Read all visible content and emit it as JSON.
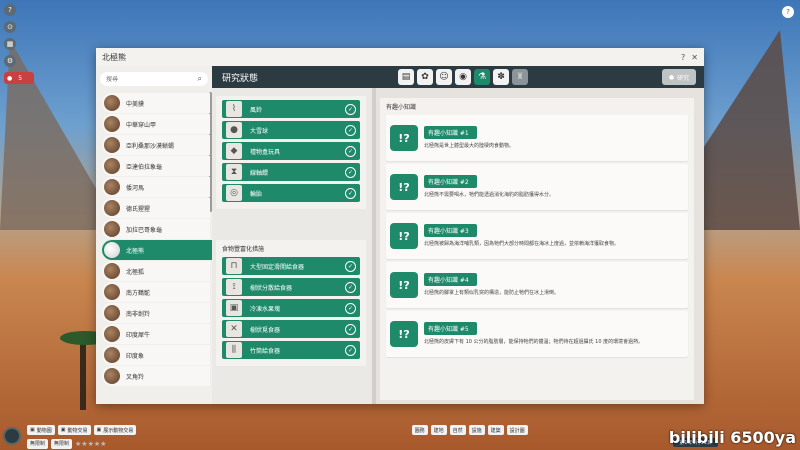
{
  "window": {
    "title": "北極熊",
    "help": "?",
    "close": "✕"
  },
  "search": {
    "placeholder": "搜尋"
  },
  "animals": [
    {
      "name": "中美貘"
    },
    {
      "name": "中華穿山甲"
    },
    {
      "name": "亞利桑那沙漠蜥蜴"
    },
    {
      "name": "亞達伯拉象龜"
    },
    {
      "name": "倭河馬"
    },
    {
      "name": "德氏猩猩"
    },
    {
      "name": "加拉巴哥象龜"
    },
    {
      "name": "北極熊"
    },
    {
      "name": "北極狐"
    },
    {
      "name": "南方鶴鴕"
    },
    {
      "name": "南非劍羚"
    },
    {
      "name": "印度犀牛"
    },
    {
      "name": "印度象"
    },
    {
      "name": "叉角羚"
    }
  ],
  "main": {
    "title": "研究狀態",
    "disabled_btn": "研究"
  },
  "category_icons": [
    "doc-icon",
    "food-icon",
    "guest-icon",
    "bag-icon",
    "flask-icon",
    "paw-icon",
    "trophy-icon"
  ],
  "enrichment": [
    {
      "label": "風鈴",
      "icon": "wind-chime-icon"
    },
    {
      "label": "大雪球",
      "icon": "snowball-icon"
    },
    {
      "label": "禮物盒玩具",
      "icon": "gift-box-icon"
    },
    {
      "label": "線軸餵",
      "icon": "spool-icon"
    },
    {
      "label": "輪胎",
      "icon": "tire-icon"
    }
  ],
  "feeding": {
    "title": "食物豐富化措施",
    "items": [
      {
        "label": "大型固定滑開給食器",
        "icon": "feeder-icon"
      },
      {
        "label": "樹狀分散給食器",
        "icon": "tree-feeder-icon"
      },
      {
        "label": "冷凍水果塊",
        "icon": "ice-block-icon"
      },
      {
        "label": "樹狀覓食器",
        "icon": "branch-feeder-icon"
      },
      {
        "label": "竹筒給食器",
        "icon": "bamboo-feeder-icon"
      }
    ]
  },
  "facts": {
    "title": "有趣小知識",
    "items": [
      {
        "title": "有趣小知識 #1",
        "text": "北極熊是世上體型最大的陸棲肉食動物。"
      },
      {
        "title": "有趣小知識 #2",
        "text": "北極熊不需要喝水，牠們能透過消化海豹的脂肪獲得水分。"
      },
      {
        "title": "有趣小知識 #3",
        "text": "北極熊被歸為海洋哺乳類，因為牠們大部分時間都在海冰上度過，並依賴海洋獲取食物。"
      },
      {
        "title": "有趣小知識 #4",
        "text": "北極熊的腳掌上有類似乳突的構造，能防止牠們在冰上滑倒。"
      },
      {
        "title": "有趣小知識 #5",
        "text": "北極熊的皮膚下有 10 公分的脂肪層，能保持牠們的體溫；牠們待在超過攝氏 10 度的環境會過熱。"
      }
    ]
  },
  "bottom": {
    "chips": [
      "動物園",
      "動物交易",
      "展示動物交易"
    ],
    "toolbar": [
      "園務",
      "建地",
      "自然",
      "設施",
      "建築",
      "設計圖"
    ],
    "row2": [
      "無限制",
      "無限制"
    ],
    "date": "第1年1月11日",
    "watermark": "bilibili 6500ya"
  }
}
